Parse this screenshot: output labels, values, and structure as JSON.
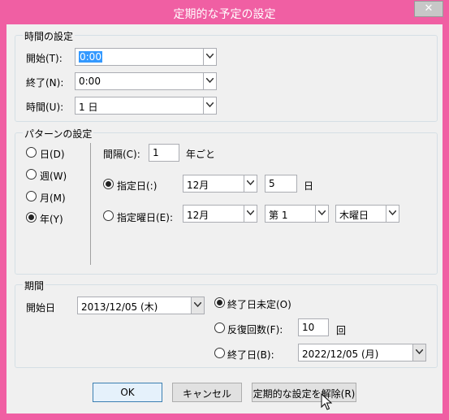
{
  "window": {
    "title": "定期的な予定の設定",
    "close_glyph": "✕"
  },
  "time_group": {
    "label": "時間の設定",
    "start_label": "開始(T):",
    "start_value": "0:00",
    "end_label": "終了(N):",
    "end_value": "0:00",
    "duration_label": "時間(U):",
    "duration_value": "1 日"
  },
  "pattern_group": {
    "label": "パターンの設定",
    "options": [
      {
        "label": "日(D)",
        "selected": false
      },
      {
        "label": "週(W)",
        "selected": false
      },
      {
        "label": "月(M)",
        "selected": false
      },
      {
        "label": "年(Y)",
        "selected": true
      }
    ],
    "interval_label": "間隔(C):",
    "interval_value": "1",
    "interval_suffix": "年ごと",
    "specific_day_label": "指定日(:)",
    "specific_day_month": "12月",
    "specific_day_day": "5",
    "specific_day_suffix": "日",
    "specific_weekday_label": "指定曜日(E):",
    "weekday_month": "12月",
    "weekday_week": "第 1",
    "weekday_day": "木曜日"
  },
  "range_group": {
    "label": "期間",
    "start_label": "開始日",
    "start_value": "2013/12/05 (木)",
    "no_end_label": "終了日未定(O)",
    "count_label": "反復回数(F):",
    "count_value": "10",
    "count_suffix": "回",
    "end_date_label": "終了日(B):",
    "end_date_value": "2022/12/05 (月)"
  },
  "buttons": {
    "ok": "OK",
    "cancel": "キャンセル",
    "remove": "定期的な設定を解除(R)"
  }
}
